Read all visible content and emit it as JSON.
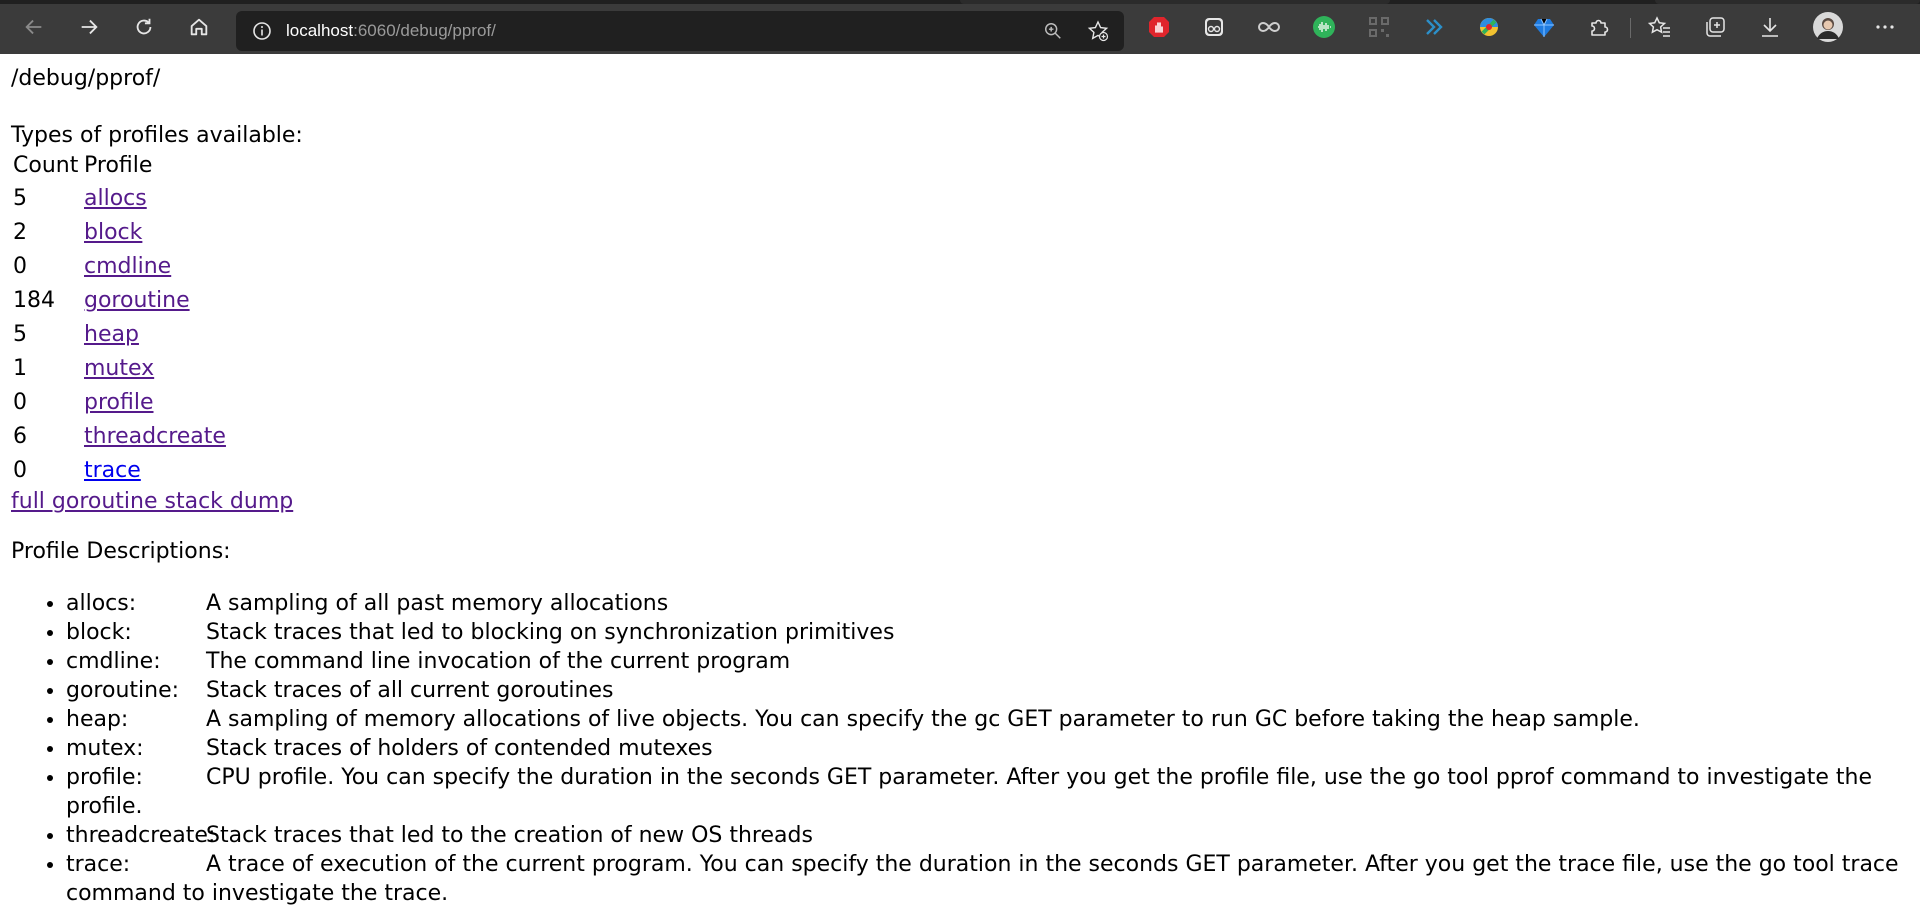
{
  "browser": {
    "url_host": "localhost",
    "url_rest": ":6060/debug/pprof/",
    "icons": [
      "back-icon",
      "forward-icon",
      "refresh-icon",
      "home-icon",
      "info-icon",
      "zoom-icon",
      "add-favorite-icon"
    ],
    "extensions": [
      "adblock-icon",
      "ghostery-icon",
      "infinity-icon",
      "audio-wave-icon",
      "qr-icon",
      "double-chevron-icon",
      "color-picker-icon",
      "diamond-icon",
      "puzzle-icon",
      "favorites-icon",
      "collections-icon",
      "download-icon",
      "avatar",
      "more-icon"
    ]
  },
  "page": {
    "path_title": "/debug/pprof/",
    "types_title": "Types of profiles available:",
    "table": {
      "headers": [
        "Count",
        "Profile"
      ],
      "rows": [
        {
          "count": "5",
          "profile": "allocs"
        },
        {
          "count": "2",
          "profile": "block"
        },
        {
          "count": "0",
          "profile": "cmdline"
        },
        {
          "count": "184",
          "profile": "goroutine"
        },
        {
          "count": "5",
          "profile": "heap"
        },
        {
          "count": "1",
          "profile": "mutex"
        },
        {
          "count": "0",
          "profile": "profile"
        },
        {
          "count": "6",
          "profile": "threadcreate"
        },
        {
          "count": "0",
          "profile": "trace"
        }
      ]
    },
    "full_dump_link": "full goroutine stack dump",
    "desc_title": "Profile Descriptions:",
    "descriptions": [
      {
        "key": "allocs:",
        "text": "A sampling of all past memory allocations"
      },
      {
        "key": "block:",
        "text": "Stack traces that led to blocking on synchronization primitives"
      },
      {
        "key": "cmdline:",
        "text": "The command line invocation of the current program"
      },
      {
        "key": "goroutine:",
        "text": "Stack traces of all current goroutines"
      },
      {
        "key": "heap:",
        "text": "A sampling of memory allocations of live objects. You can specify the gc GET parameter to run GC before taking the heap sample."
      },
      {
        "key": "mutex:",
        "text": "Stack traces of holders of contended mutexes"
      },
      {
        "key": "profile:",
        "text": "CPU profile. You can specify the duration in the seconds GET parameter. After you get the profile file, use the go tool pprof command to investigate the profile."
      },
      {
        "key": "threadcreate:",
        "text": "Stack traces that led to the creation of new OS threads"
      },
      {
        "key": "trace:",
        "text": "A trace of execution of the current program. You can specify the duration in the seconds GET parameter. After you get the trace file, use the go tool trace command to investigate the trace."
      }
    ]
  },
  "colors": {
    "toolbar_bg": "#3b3b3b",
    "address_bg": "#202020",
    "visited_link": "#551a8b",
    "unvisited_link": "#0000ee"
  }
}
